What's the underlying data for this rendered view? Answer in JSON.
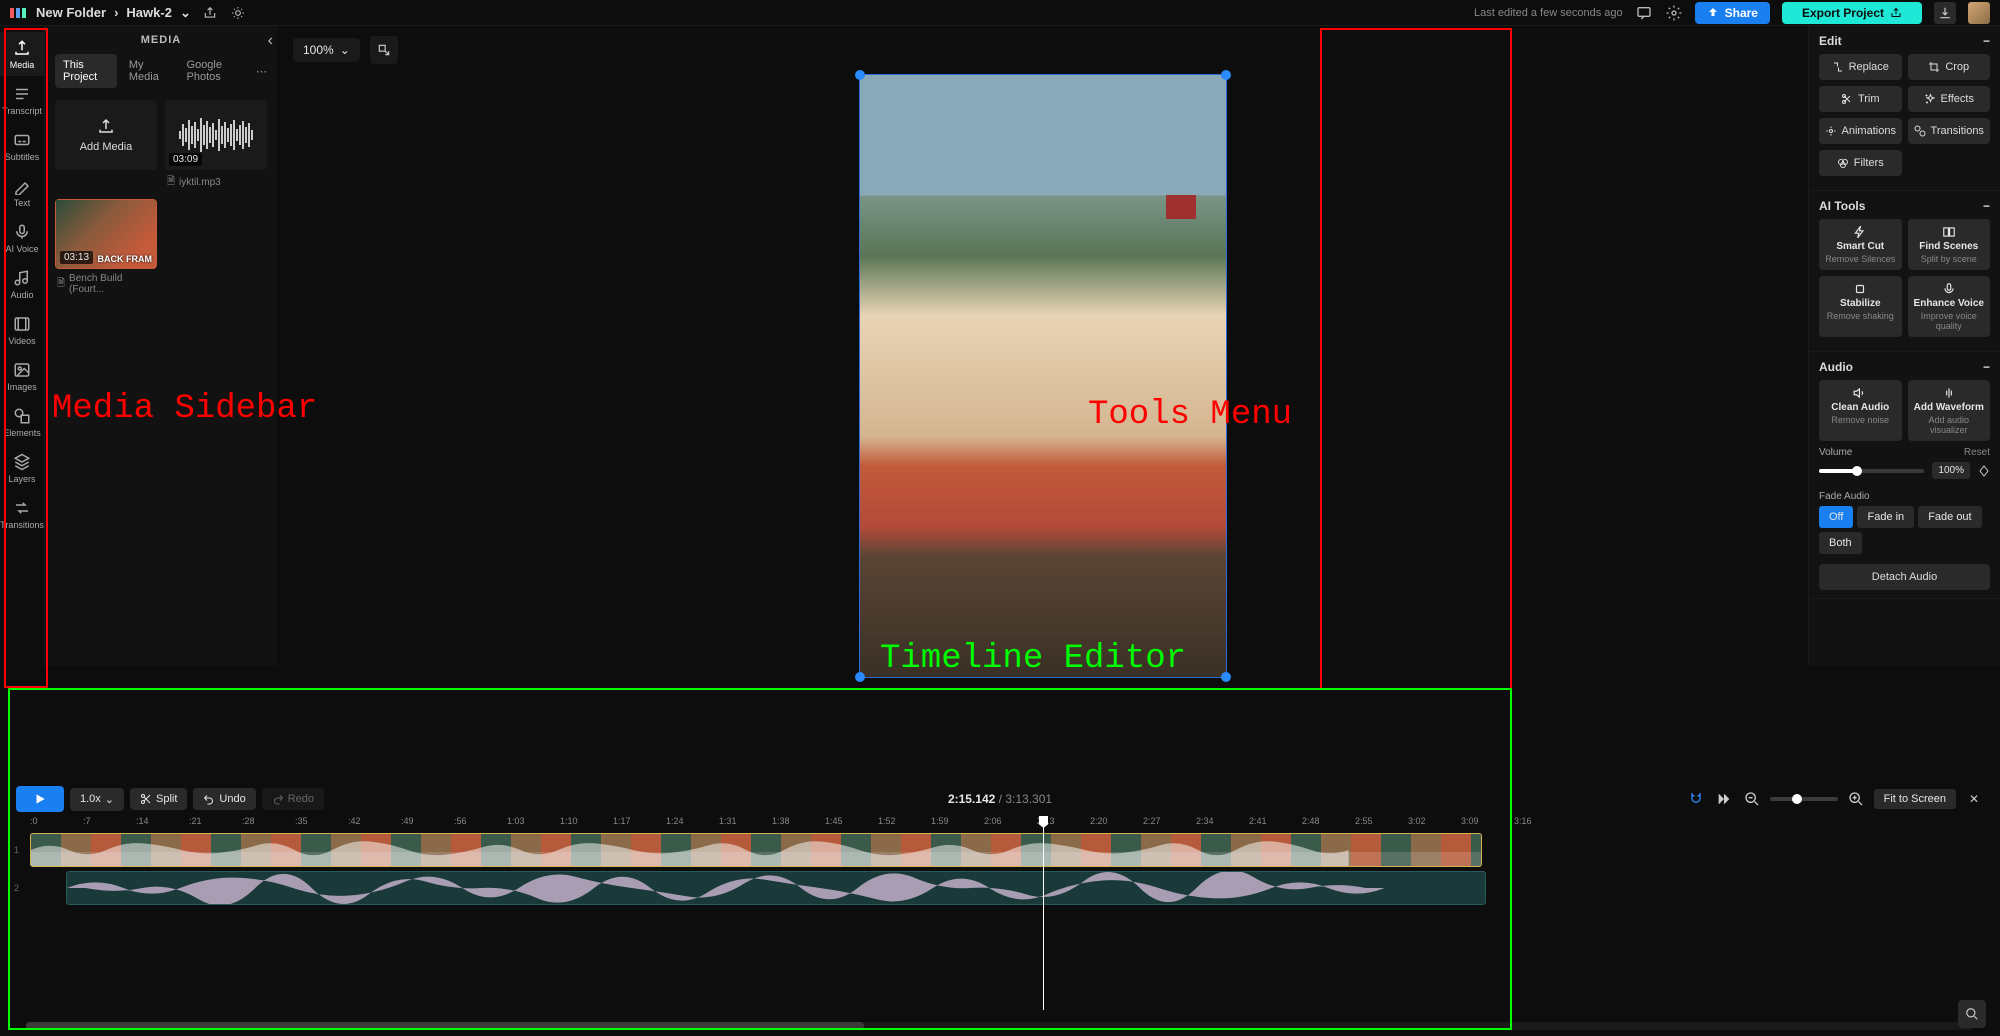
{
  "topbar": {
    "breadcrumb_folder": "New Folder",
    "breadcrumb_project": "Hawk-2",
    "last_edited": "Last edited a few seconds ago",
    "share_label": "Share",
    "export_label": "Export Project"
  },
  "sidebar": {
    "items": [
      {
        "label": "Media"
      },
      {
        "label": "Transcript"
      },
      {
        "label": "Subtitles"
      },
      {
        "label": "Text"
      },
      {
        "label": "AI Voice"
      },
      {
        "label": "Audio"
      },
      {
        "label": "Videos"
      },
      {
        "label": "Images"
      },
      {
        "label": "Elements"
      },
      {
        "label": "Layers"
      },
      {
        "label": "Transitions"
      }
    ]
  },
  "media_panel": {
    "header": "MEDIA",
    "tabs": [
      "This Project",
      "My Media",
      "Google Photos"
    ],
    "add_media": "Add Media",
    "audio_item": {
      "duration": "03:09",
      "name": "iyktil.mp3"
    },
    "video_item": {
      "duration": "03:13",
      "overlay": "BACK FRAM",
      "name": "Bench Build (Fourt..."
    }
  },
  "canvas": {
    "zoom": "100%"
  },
  "right_panel": {
    "edit": {
      "title": "Edit",
      "replace": "Replace",
      "crop": "Crop",
      "trim": "Trim",
      "effects": "Effects",
      "animations": "Animations",
      "transitions": "Transitions",
      "filters": "Filters"
    },
    "ai": {
      "title": "AI Tools",
      "cards": [
        {
          "t1": "Smart Cut",
          "t2": "Remove Silences"
        },
        {
          "t1": "Find Scenes",
          "t2": "Split by scene"
        },
        {
          "t1": "Stabilize",
          "t2": "Remove shaking"
        },
        {
          "t1": "Enhance Voice",
          "t2": "Improve voice quality"
        }
      ]
    },
    "audio": {
      "title": "Audio",
      "clean": {
        "t1": "Clean Audio",
        "t2": "Remove noise"
      },
      "wave": {
        "t1": "Add Waveform",
        "t2": "Add audio visualizer"
      },
      "volume_label": "Volume",
      "reset": "Reset",
      "volume_value": "100%",
      "fade_label": "Fade Audio",
      "fade_opts": [
        "Off",
        "Fade in",
        "Fade out",
        "Both"
      ],
      "detach": "Detach Audio"
    }
  },
  "timeline": {
    "play_speed": "1.0x",
    "split": "Split",
    "undo": "Undo",
    "redo": "Redo",
    "current_time": "2:15.142",
    "total_time": "3:13.301",
    "fit": "Fit to Screen",
    "ruler": [
      ":0",
      ":7",
      ":14",
      ":21",
      ":28",
      ":35",
      ":42",
      ":49",
      ":56",
      "1:03",
      "1:10",
      "1:17",
      "1:24",
      "1:31",
      "1:38",
      "1:45",
      "1:52",
      "1:59",
      "2:06",
      "2:13",
      "2:20",
      "2:27",
      "2:34",
      "2:41",
      "2:48",
      "2:55",
      "3:02",
      "3:09",
      "3:16"
    ]
  },
  "annotations": {
    "media_sidebar": "Media Sidebar",
    "tools_menu": "Tools Menu",
    "timeline_editor": "Timeline Editor"
  }
}
